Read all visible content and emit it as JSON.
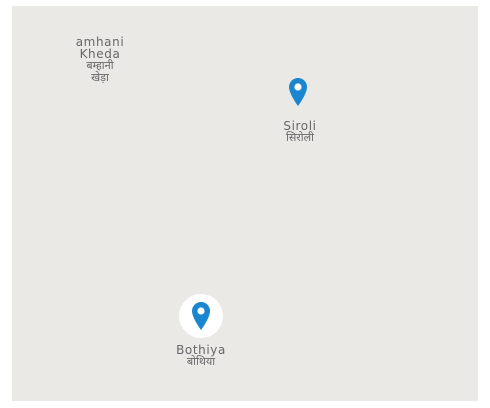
{
  "map": {
    "background_color": "#ebe9e5",
    "marker_color": "#1a86d0",
    "places": [
      {
        "id": "bamhani-kheda",
        "en_line1": "amhani",
        "en_line2": "Kheda",
        "hi_line1": "बम्हानी",
        "hi_line2": "खेड़ा"
      },
      {
        "id": "siroli",
        "en": "Siroli",
        "hi": "सिरोली"
      },
      {
        "id": "bothiya",
        "en": "Bothiya",
        "hi": "बोथिया"
      }
    ],
    "markers": [
      {
        "place": "Siroli",
        "icon": "map-pin-icon",
        "selected": false
      },
      {
        "place": "Bothiya",
        "icon": "map-pin-icon",
        "selected": true
      }
    ]
  }
}
